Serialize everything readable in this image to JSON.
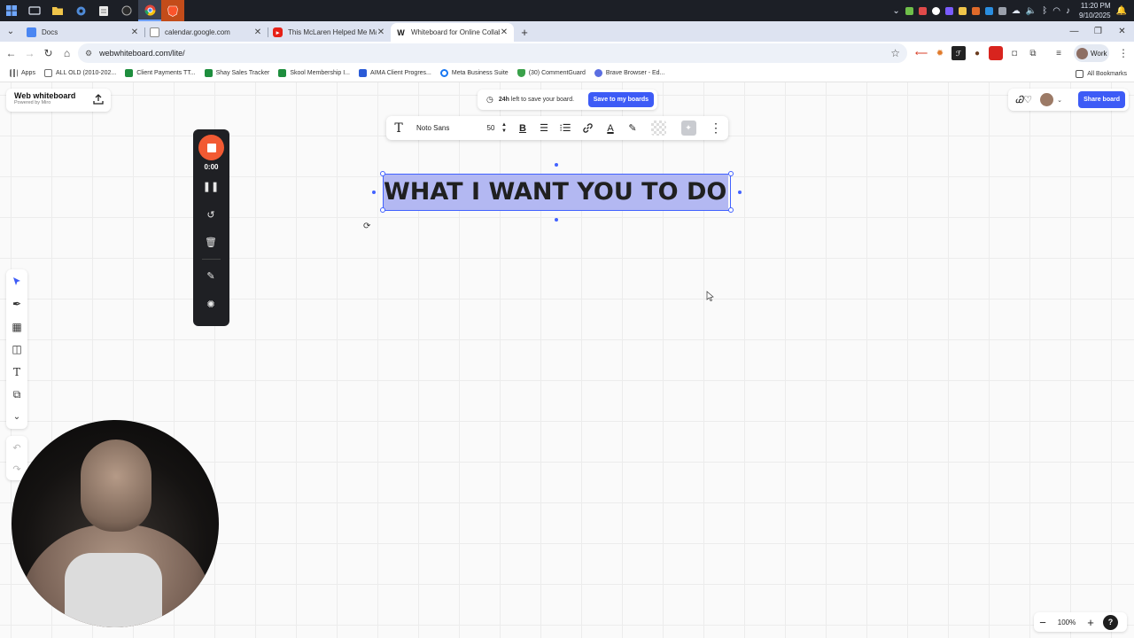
{
  "taskbar": {
    "clock_time": "11:20 PM",
    "clock_date": "9/10/2025"
  },
  "tabs": [
    {
      "title": "Docs",
      "favicon_color": "#4a86f2"
    },
    {
      "title": "calendar.google.com",
      "favicon_color": "#8a8a8a"
    },
    {
      "title": "This McLaren Helped Me Make",
      "favicon_color": "#e62117"
    },
    {
      "title": "Whiteboard for Online Collabo",
      "favicon_color": "#111111",
      "favicon_glyph": "W"
    }
  ],
  "address_bar": {
    "url": "webwhiteboard.com/lite/",
    "profile_label": "Work"
  },
  "bookmarks": [
    {
      "label": "Apps",
      "color": "#7a7a7a"
    },
    {
      "label": "ALL OLD (2010-202...",
      "color": "#6d6d6d"
    },
    {
      "label": "Client Payments TT...",
      "color": "#1e8e3e"
    },
    {
      "label": "Shay Sales Tracker",
      "color": "#1e8e3e"
    },
    {
      "label": "Skool Membership I...",
      "color": "#1e8e3e"
    },
    {
      "label": "AIMA Client Progres...",
      "color": "#2a5bd7"
    },
    {
      "label": "Meta Business Suite",
      "color": "#1877f2"
    },
    {
      "label": "(30) CommentGuard",
      "color": "#3aa14a"
    },
    {
      "label": "Brave Browser - Ed...",
      "color": "#5b6ee1"
    }
  ],
  "bookmarks_all": "All Bookmarks",
  "whiteboard": {
    "brand_title": "Web whiteboard",
    "brand_sub": "Powered by Miro",
    "save_hours": "24h",
    "save_text": "left to save your board.",
    "save_button": "Save to my boards",
    "share_button": "Share board",
    "collab_logo": "Ꮚ♡",
    "accent_color": "#3d5bf6"
  },
  "text_toolbar": {
    "font": "Noto Sans",
    "size": "50"
  },
  "canvas_text": "WHAT I WANT YOU TO DO",
  "recorder": {
    "time": "0:00",
    "stop_color": "#f25a33"
  },
  "zoom": {
    "level": "100%",
    "help": "?"
  }
}
